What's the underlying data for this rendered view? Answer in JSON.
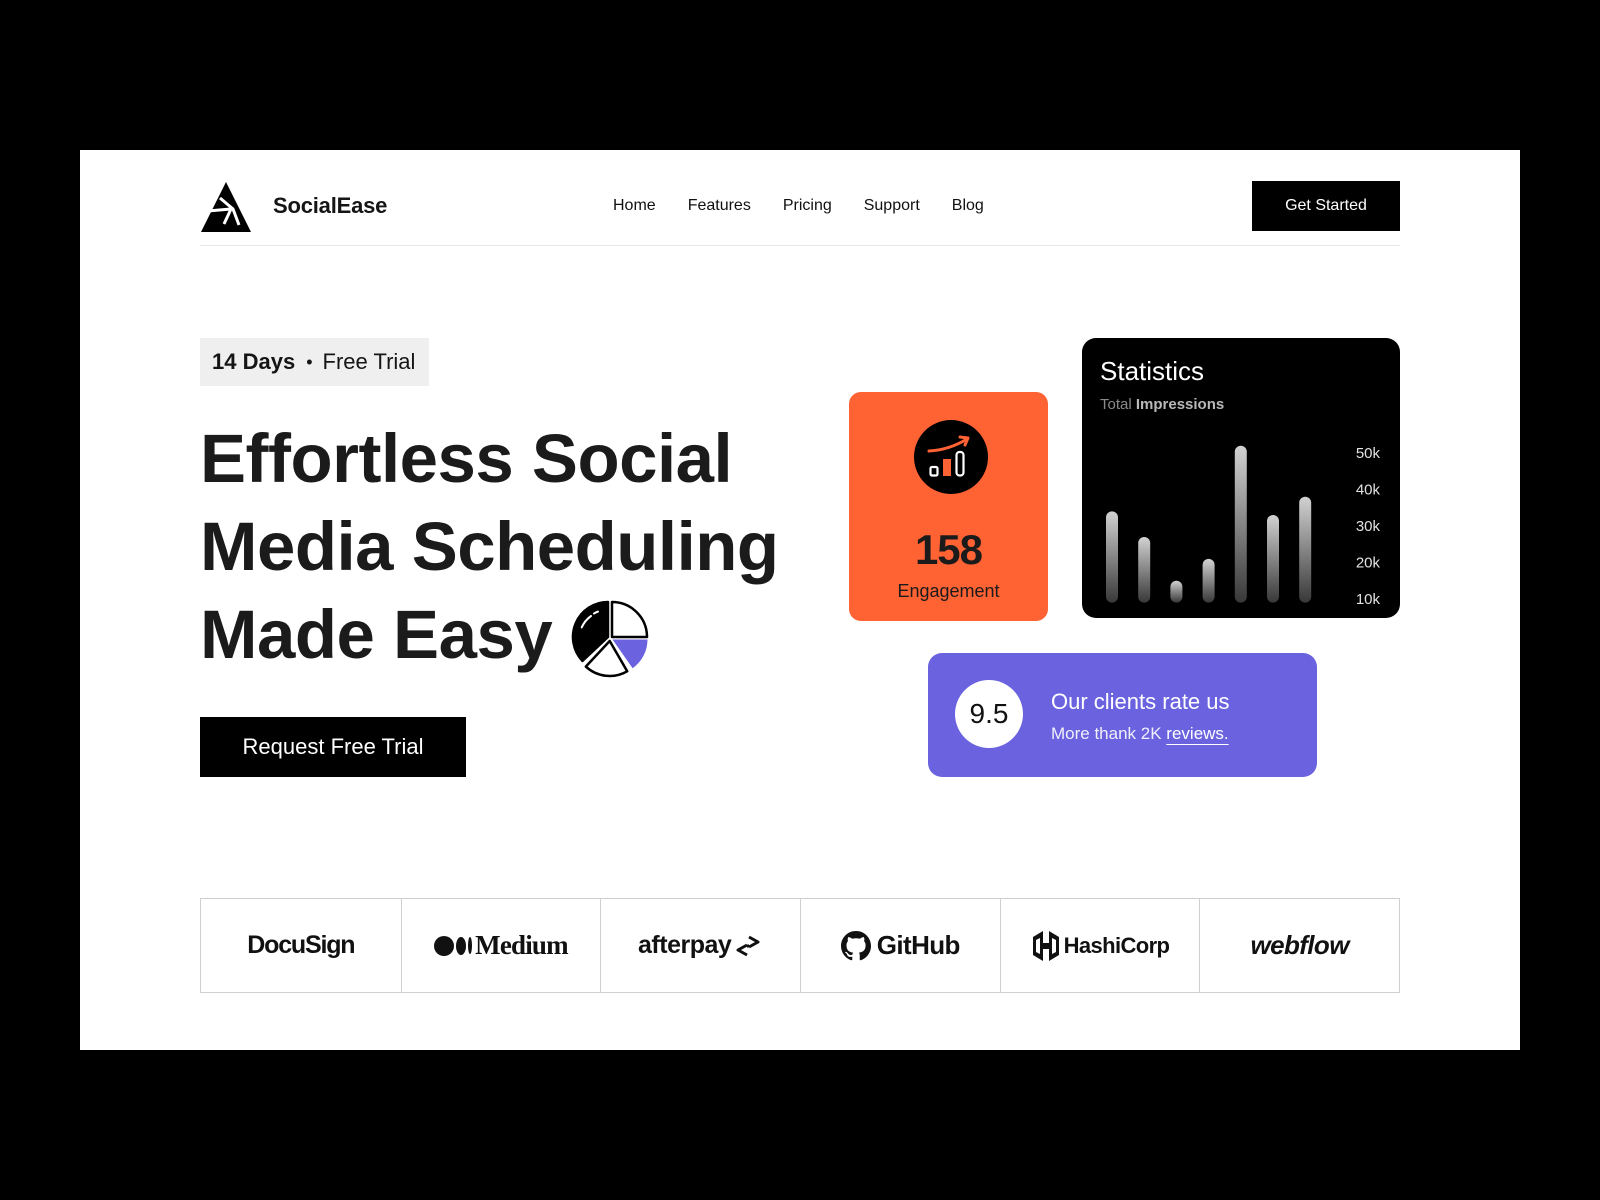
{
  "brand": {
    "name": "SocialEase",
    "logo_icon": "triangle-logo-icon"
  },
  "nav": {
    "items": [
      {
        "label": "Home"
      },
      {
        "label": "Features"
      },
      {
        "label": "Pricing"
      },
      {
        "label": "Support"
      },
      {
        "label": "Blog"
      }
    ],
    "cta_label": "Get Started"
  },
  "hero": {
    "badge": {
      "days": "14 Days",
      "separator": "•",
      "label": "Free Trial"
    },
    "headline_lines": [
      "Effortless Social",
      "Media Scheduling",
      "Made Easy"
    ],
    "headline_icon": "pie-chart-icon",
    "cta_label": "Request Free Trial"
  },
  "engagement_card": {
    "icon": "growth-chart-icon",
    "value": "158",
    "label": "Engagement"
  },
  "statistics_card": {
    "title": "Statistics",
    "subtitle_prefix": "Total",
    "subtitle_emphasis": "Impressions"
  },
  "rating_card": {
    "score": "9.5",
    "title": "Our clients rate us",
    "subtitle_prefix": "More thank 2K",
    "subtitle_link": "reviews."
  },
  "partners": [
    {
      "name": "DocuSign"
    },
    {
      "name": "Medium",
      "icon": "medium-dots-icon"
    },
    {
      "name": "afterpay",
      "icon": "afterpay-arrows-icon"
    },
    {
      "name": "GitHub",
      "icon": "github-octocat-icon"
    },
    {
      "name": "HashiCorp",
      "icon": "hashicorp-icon"
    },
    {
      "name": "webflow"
    }
  ],
  "colors": {
    "accent_orange": "#FF6233",
    "accent_purple": "#6A62DE",
    "primary_dark": "#000000",
    "badge_bg": "#EFEFEF"
  },
  "chart_data": {
    "type": "bar",
    "title": "Statistics",
    "subtitle": "Total Impressions",
    "unit": "k",
    "values": [
      34,
      27,
      15,
      21,
      52,
      33,
      38
    ],
    "baseline": 9,
    "y_tick_values": [
      50,
      40,
      30,
      20,
      10
    ],
    "y_tick_labels": [
      "50k",
      "40k",
      "30k",
      "20k",
      "10k"
    ],
    "ylim": [
      9,
      52
    ],
    "y_axis_side": "right",
    "grid": false,
    "legend": "none"
  }
}
